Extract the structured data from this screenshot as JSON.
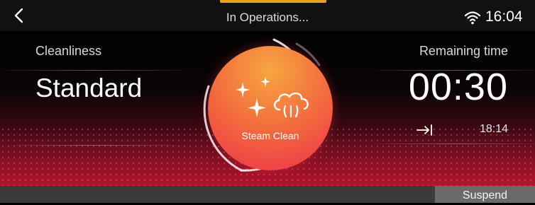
{
  "header": {
    "title": "In Operations...",
    "time": "16:04",
    "accent_color": "#e6a21a"
  },
  "left_panel": {
    "label": "Cleanliness",
    "value": "Standard"
  },
  "center": {
    "mode_label": "Steam Clean",
    "gradient": [
      "#f7a640",
      "#ee3049"
    ]
  },
  "right_panel": {
    "label": "Remaining time",
    "value": "00:30",
    "end_time": "18:14"
  },
  "footer": {
    "suspend_label": "Suspend"
  },
  "icons": [
    "back-arrow-icon",
    "wifi-icon",
    "sparkle-icon",
    "steam-cloud-icon",
    "end-time-icon"
  ]
}
